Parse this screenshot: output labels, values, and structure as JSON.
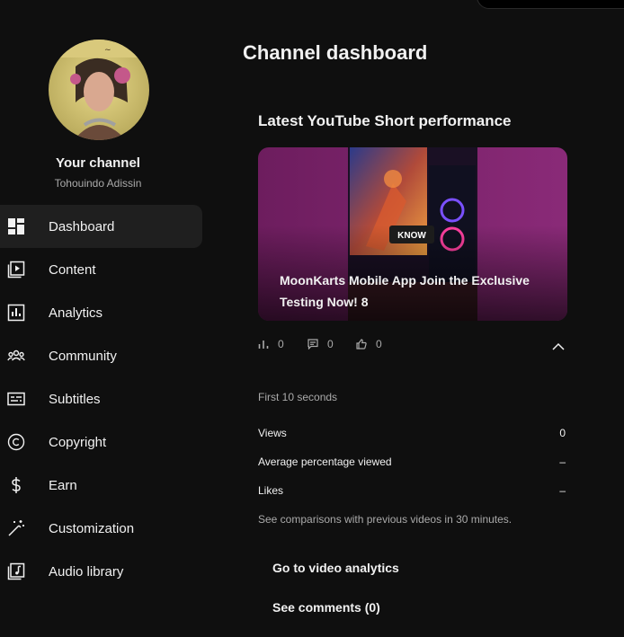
{
  "channel": {
    "title": "Your channel",
    "handle": "Tohouindo Adissin"
  },
  "nav": {
    "items": [
      {
        "label": "Dashboard",
        "icon": "dashboard-icon",
        "active": true
      },
      {
        "label": "Content",
        "icon": "content-icon"
      },
      {
        "label": "Analytics",
        "icon": "analytics-icon"
      },
      {
        "label": "Community",
        "icon": "community-icon"
      },
      {
        "label": "Subtitles",
        "icon": "subtitles-icon"
      },
      {
        "label": "Copyright",
        "icon": "copyright-icon"
      },
      {
        "label": "Earn",
        "icon": "dollar-icon"
      },
      {
        "label": "Customization",
        "icon": "magic-wand-icon"
      },
      {
        "label": "Audio library",
        "icon": "audio-library-icon"
      }
    ]
  },
  "main": {
    "title": "Channel dashboard",
    "card": {
      "title": "Latest YouTube Short performance",
      "thumbnail": {
        "overlay_badge": "KNOW",
        "video_title": "MoonKarts Mobile App Join the Exclusive Testing Now! 8"
      },
      "stats": {
        "views": "0",
        "comments": "0",
        "likes": "0"
      },
      "section_label": "First 10 seconds",
      "metrics": [
        {
          "label": "Views",
          "value": "0"
        },
        {
          "label": "Average percentage viewed",
          "value": "–"
        },
        {
          "label": "Likes",
          "value": "–"
        }
      ],
      "note": "See comparisons with previous videos in 30 minutes.",
      "actions": {
        "analytics": "Go to video analytics",
        "comments": "See comments (0)"
      }
    }
  },
  "colors": {
    "background": "#0f0f0f",
    "active_nav": "#1f1f1f",
    "text_primary": "#f1f1f1",
    "text_secondary": "#aaaaaa"
  }
}
